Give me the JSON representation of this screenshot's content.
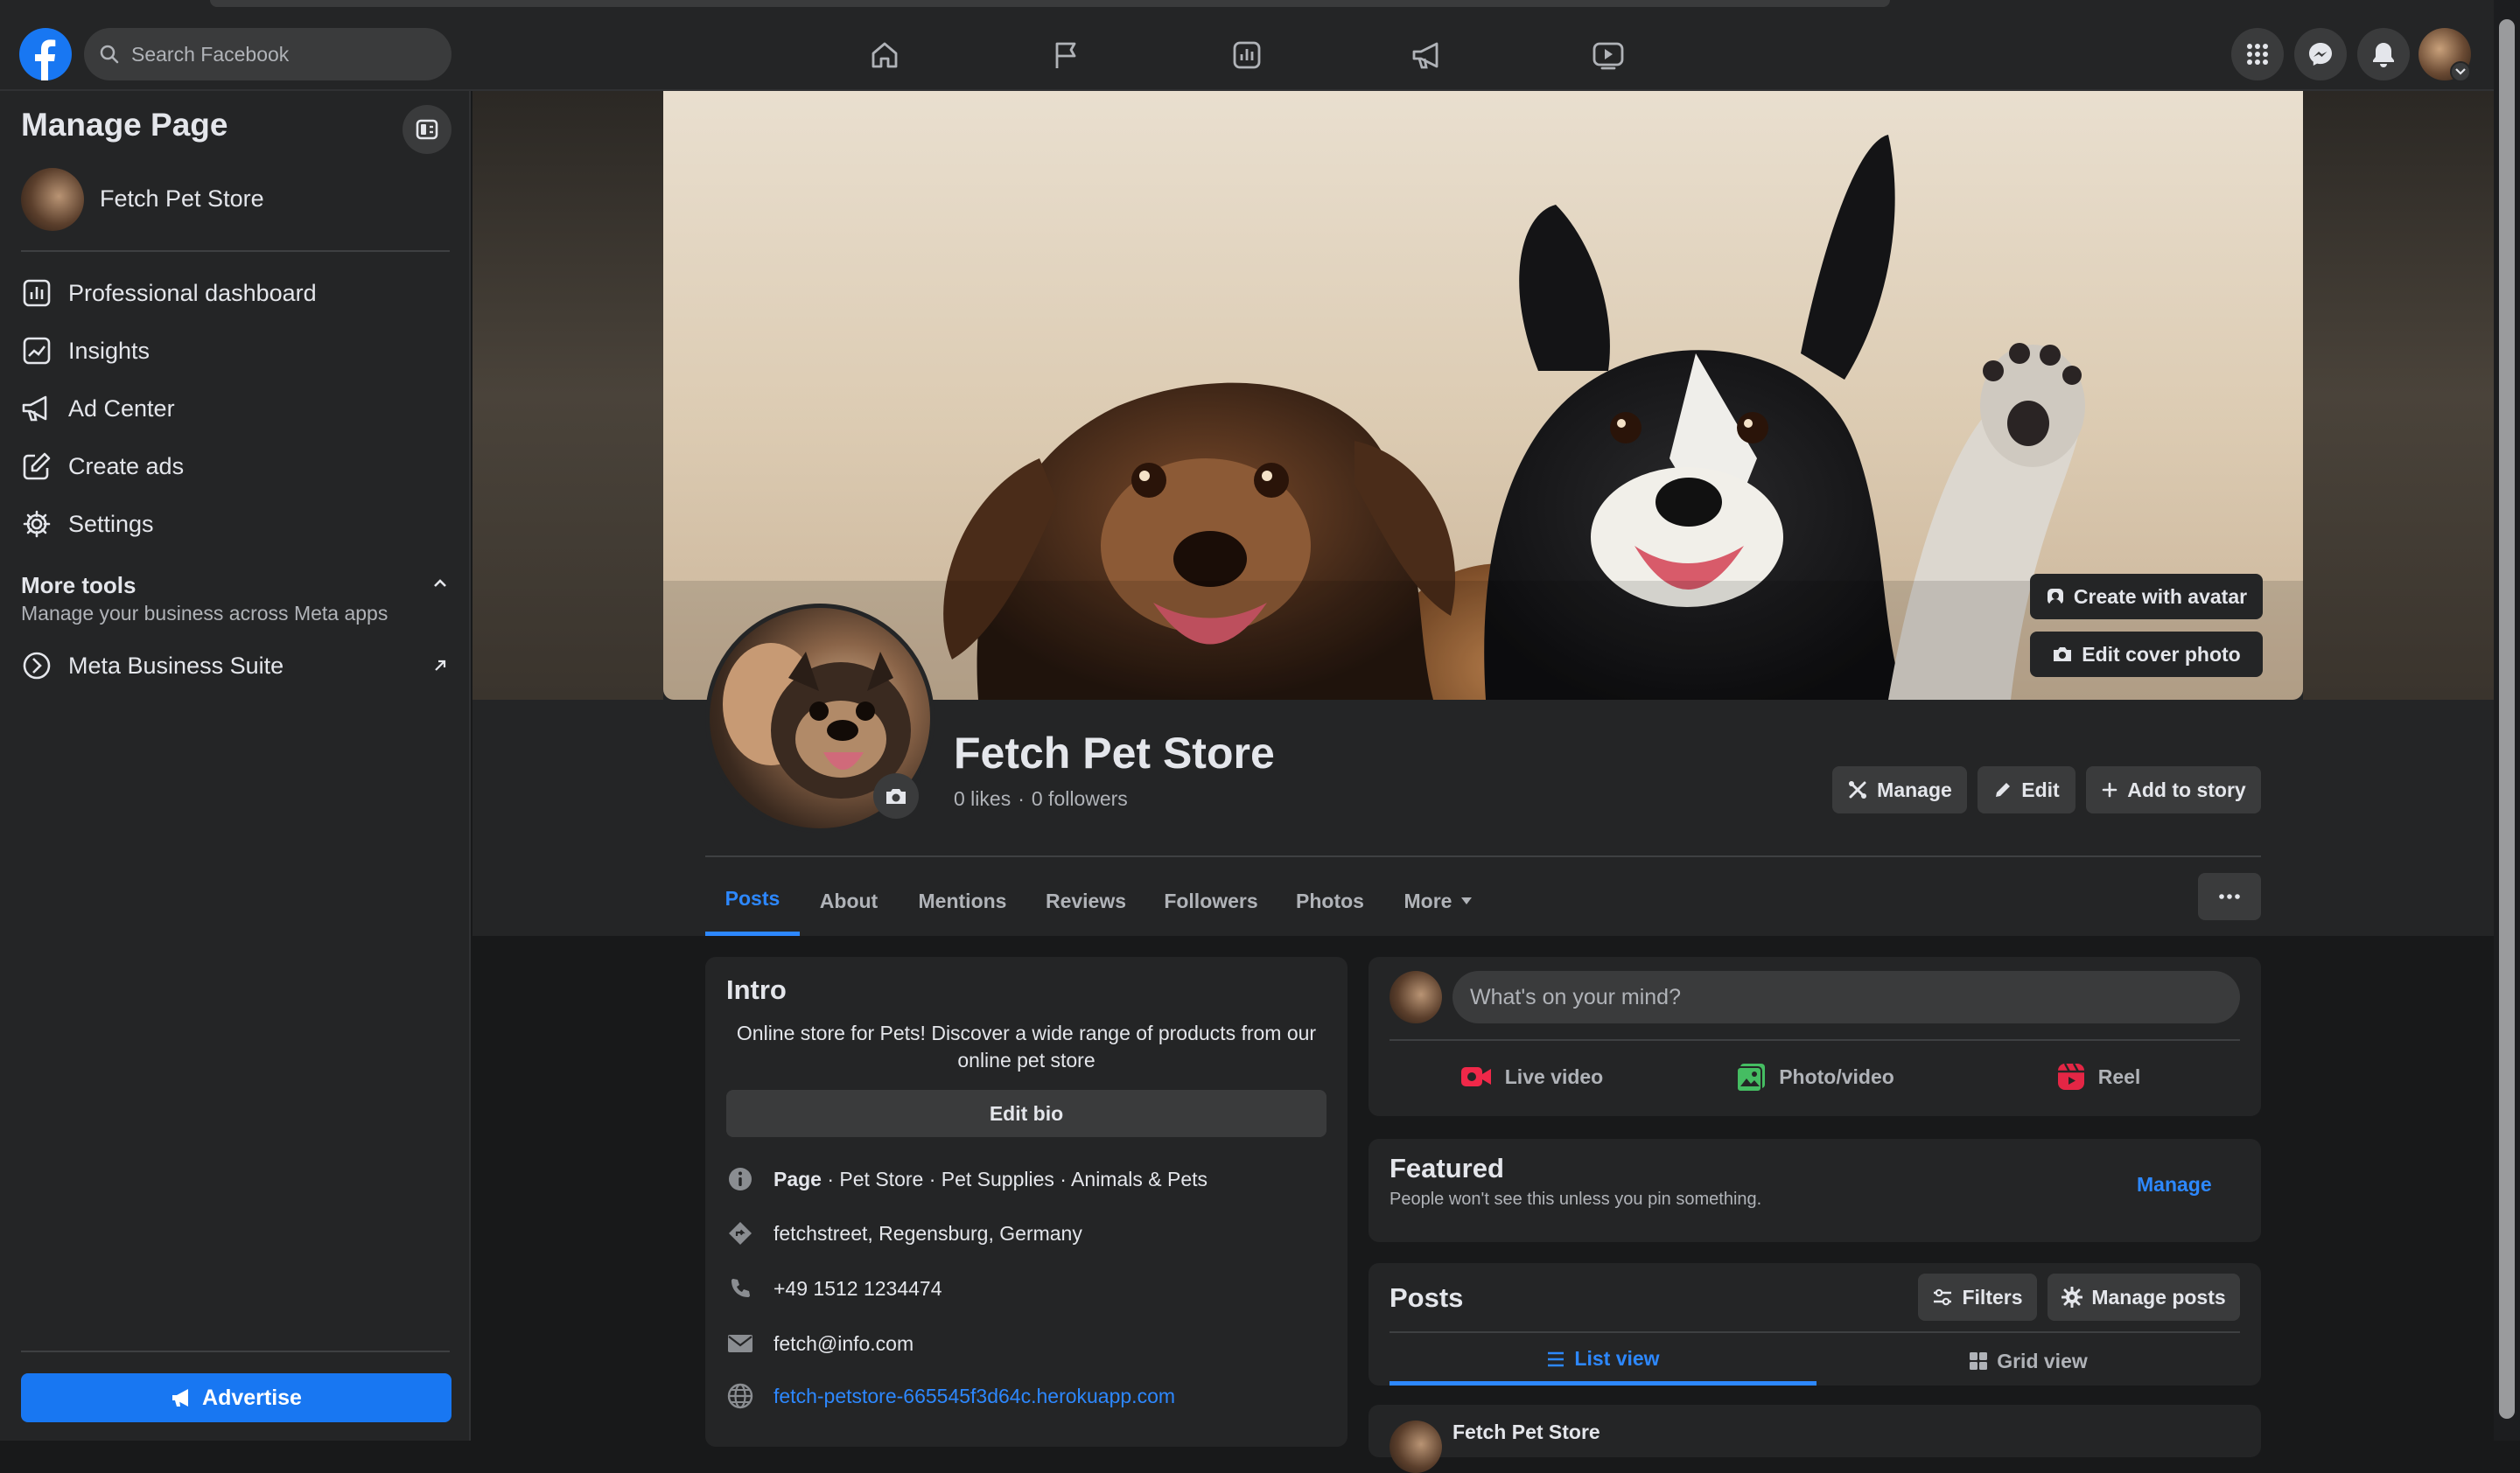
{
  "header": {
    "search_placeholder": "Search Facebook",
    "nav_icons": [
      "home-icon",
      "flag-icon",
      "dashboard-icon",
      "megaphone-icon",
      "video-icon"
    ],
    "right_icons": [
      "menu-grid-icon",
      "messenger-icon",
      "bell-icon"
    ]
  },
  "sidebar": {
    "title": "Manage Page",
    "page_name": "Fetch Pet Store",
    "items": [
      {
        "label": "Professional dashboard",
        "icon": "dashboard-icon"
      },
      {
        "label": "Insights",
        "icon": "insights-icon"
      },
      {
        "label": "Ad Center",
        "icon": "megaphone-icon"
      },
      {
        "label": "Create ads",
        "icon": "edit-icon"
      },
      {
        "label": "Settings",
        "icon": "gear-icon"
      }
    ],
    "more_tools_title": "More tools",
    "more_tools_subtitle": "Manage your business across Meta apps",
    "meta_business_suite": "Meta Business Suite",
    "advertise_label": "Advertise"
  },
  "profile": {
    "cover_buttons": {
      "create_avatar": "Create with avatar",
      "edit_cover": "Edit cover photo"
    },
    "name": "Fetch Pet Store",
    "likes": "0 likes",
    "separator": "·",
    "followers": "0 followers",
    "actions": {
      "manage": "Manage",
      "edit": "Edit",
      "add_story": "Add to story"
    },
    "tabs": [
      "Posts",
      "About",
      "Mentions",
      "Reviews",
      "Followers",
      "Photos",
      "More"
    ],
    "active_tab": "Posts"
  },
  "intro": {
    "title": "Intro",
    "bio": "Online store for Pets! Discover a wide range of products from our online pet store",
    "edit_bio": "Edit bio",
    "category_prefix": "Page",
    "category": " · Pet Store · Pet Supplies · Animals & Pets",
    "address": "fetchstreet, Regensburg, Germany",
    "phone": "+49 1512 1234474",
    "email": "fetch@info.com",
    "website": "fetch-petstore-665545f3d64c.herokuapp.com"
  },
  "composer": {
    "placeholder": "What's on your mind?",
    "live_video": "Live video",
    "photo_video": "Photo/video",
    "reel": "Reel"
  },
  "featured": {
    "title": "Featured",
    "subtitle": "People won't see this unless you pin something.",
    "manage": "Manage"
  },
  "posts": {
    "title": "Posts",
    "filters": "Filters",
    "manage_posts": "Manage posts",
    "list_view": "List view",
    "grid_view": "Grid view",
    "first_post_author": "Fetch Pet Store"
  },
  "colors": {
    "accent": "#2d88ff",
    "brand": "#1877f2",
    "background": "#18191a",
    "surface": "#242526",
    "live_video": "#f02849",
    "photo_video": "#45bd62",
    "reel": "#e42645"
  }
}
